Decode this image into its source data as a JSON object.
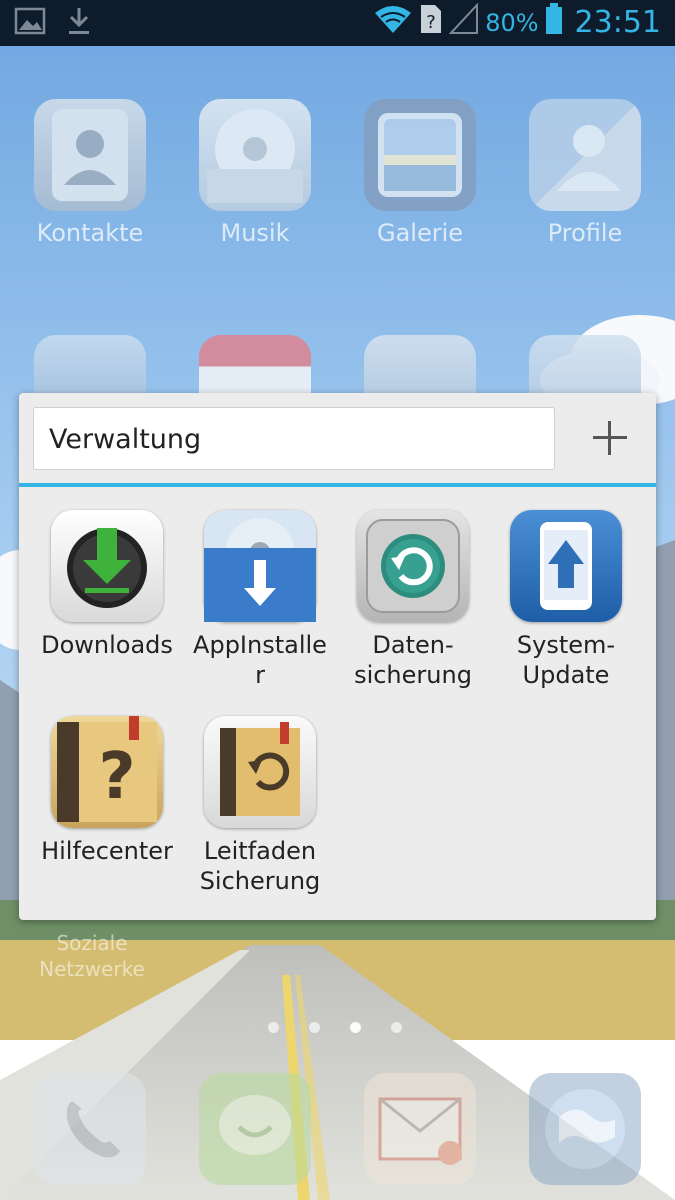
{
  "status_bar": {
    "battery_percent": "80%",
    "time": "23:51",
    "icons": [
      "image-icon",
      "download-icon",
      "wifi-icon",
      "no-sim-icon",
      "signal-icon",
      "battery-icon"
    ]
  },
  "home_apps": [
    {
      "label": "Kontakte",
      "icon": "contacts-icon"
    },
    {
      "label": "Musik",
      "icon": "music-icon"
    },
    {
      "label": "Galerie",
      "icon": "gallery-icon"
    },
    {
      "label": "Profile",
      "icon": "profile-icon"
    }
  ],
  "home_row2_icons": [
    "file-manager-icon",
    "calendar-icon",
    "clock-icon",
    "weather-icon"
  ],
  "home_folder_label": "Soziale Netzwerke",
  "folder": {
    "name": "Verwaltung",
    "apps": [
      {
        "label": "Downloads",
        "icon": "downloads-icon"
      },
      {
        "label": "AppInstalle\nr",
        "icon": "app-installer-icon"
      },
      {
        "label": "Daten-\nsicherung",
        "icon": "backup-icon"
      },
      {
        "label": "System-\nUpdate",
        "icon": "system-update-icon"
      },
      {
        "label": "Hilfecenter",
        "icon": "help-center-icon"
      },
      {
        "label": "Leitfaden\nSicherung",
        "icon": "backup-guide-icon"
      }
    ]
  },
  "page_indicator": {
    "pages": 4,
    "active": 2
  },
  "dock": [
    "phone-icon",
    "messaging-icon",
    "email-icon",
    "browser-icon"
  ],
  "colors": {
    "accent": "#33b5e5",
    "status_bar": "#0d1b2b",
    "folder_bg": "#ececec"
  }
}
